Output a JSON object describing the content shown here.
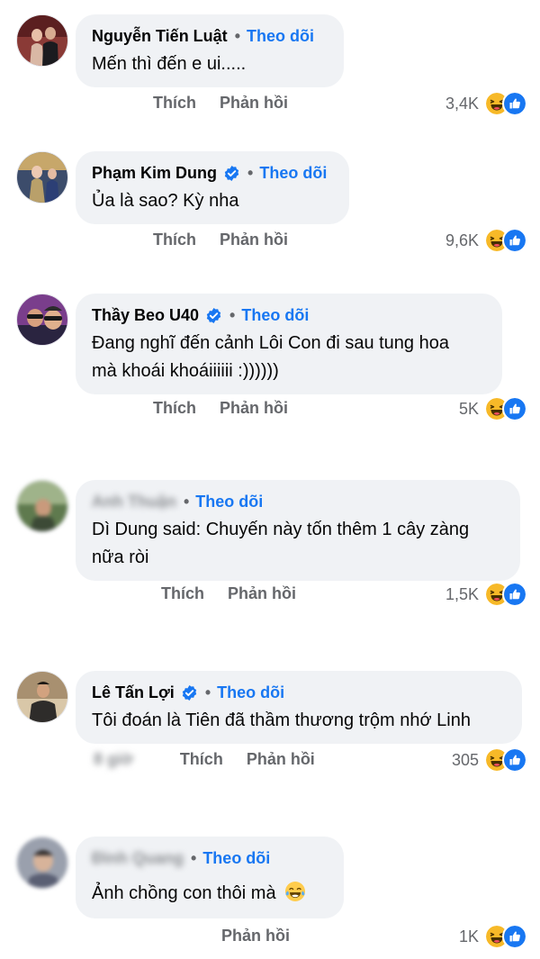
{
  "ui": {
    "follow_label": "Theo dõi",
    "like_label": "Thích",
    "reply_label": "Phản hồi",
    "separator": "•"
  },
  "comments": [
    {
      "name": "Nguyễn Tiến Luật",
      "verified": false,
      "text": "Mến thì đến e ui.....",
      "reaction_count": "3,4K"
    },
    {
      "name": "Phạm Kim Dung",
      "verified": true,
      "text": "Ủa là sao? Kỳ nha",
      "reaction_count": "9,6K"
    },
    {
      "name": "Thầy Beo U40",
      "verified": true,
      "text_lines": [
        "Đang nghĩ đến cảnh Lôi Con đi sau tung hoa",
        "mà khoái khoáiiiiii :))))))"
      ],
      "reaction_count": "5K"
    },
    {
      "name": "Anh Thuận",
      "verified": false,
      "name_blurred": true,
      "text_lines": [
        "Dì Dung said: Chuyến này tốn thêm 1 cây zàng",
        "nữa ròi"
      ],
      "reaction_count": "1,5K"
    },
    {
      "name": "Lê Tấn Lợi",
      "verified": true,
      "text": "Tôi đoán là Tiên đã thầm thương trộm nhớ Linh",
      "time_blurred": "8 giờ",
      "reaction_count": "305"
    },
    {
      "name": "Đình Quang",
      "verified": false,
      "name_blurred": true,
      "text": "Ảnh chồng con thôi mà",
      "text_emoji": "tears-of-joy-emoji",
      "reaction_count": "1K"
    }
  ],
  "icons": {
    "haha": "haha-reaction-icon",
    "like": "like-reaction-icon",
    "verified": "verified-badge-icon"
  },
  "colors": {
    "bubble": "#f0f2f5",
    "follow": "#1877f2",
    "meta": "#65676b",
    "verified": "#1877f2"
  }
}
